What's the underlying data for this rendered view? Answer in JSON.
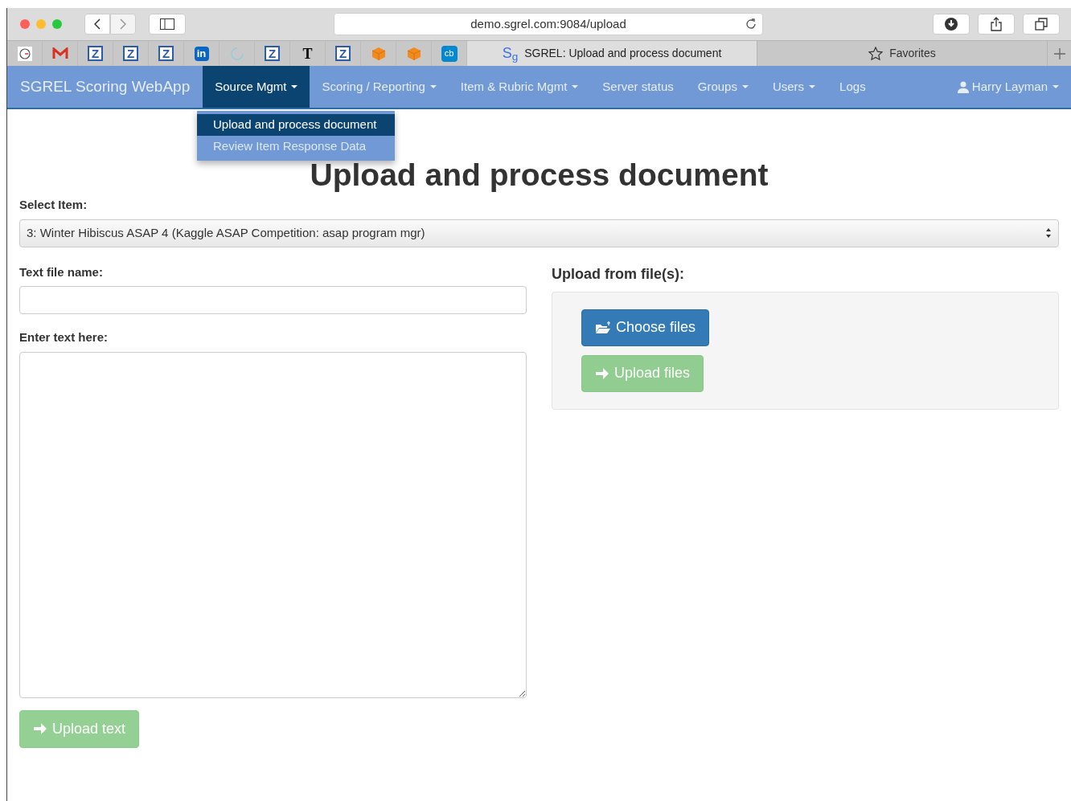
{
  "browser": {
    "url": "demo.sgrel.com:9084/upload",
    "bookmarks": [
      {
        "kind": "clock"
      },
      {
        "kind": "gmail"
      },
      {
        "kind": "z",
        "label": "Z"
      },
      {
        "kind": "z",
        "label": "Z"
      },
      {
        "kind": "z",
        "label": "Z"
      },
      {
        "kind": "linkedin",
        "label": "in"
      },
      {
        "kind": "spinner"
      },
      {
        "kind": "z",
        "label": "Z"
      },
      {
        "kind": "nyt",
        "label": "T"
      },
      {
        "kind": "z",
        "label": "Z"
      },
      {
        "kind": "cube"
      },
      {
        "kind": "cube"
      },
      {
        "kind": "cb",
        "label": "cb"
      }
    ],
    "tab": {
      "favicon": "S$_{g}$",
      "title": "SGREL: Upload and process document"
    },
    "favorites": "Favorites"
  },
  "navbar": {
    "brand": "SGREL Scoring WebApp",
    "items": [
      {
        "label": "Source Mgmt",
        "dropdown": true,
        "selected": true
      },
      {
        "label": "Scoring / Reporting",
        "dropdown": true,
        "selected": false
      },
      {
        "label": "Item & Rubric Mgmt",
        "dropdown": true,
        "selected": false
      },
      {
        "label": "Server status",
        "dropdown": false,
        "selected": false
      },
      {
        "label": "Groups",
        "dropdown": true,
        "selected": false
      },
      {
        "label": "Users",
        "dropdown": true,
        "selected": false
      },
      {
        "label": "Logs",
        "dropdown": false,
        "selected": false
      }
    ],
    "user": {
      "label": "Harry Layman",
      "dropdown": true
    },
    "menu": [
      {
        "label": "Upload and process document",
        "selected": true
      },
      {
        "label": "Review Item Response Data",
        "selected": false
      }
    ]
  },
  "page": {
    "title": "Upload and process document",
    "select_label": "Select Item:",
    "select_value": "3: Winter Hibiscus ASAP 4 (Kaggle ASAP Competition: asap program mgr)",
    "file_name_label": "Text file name:",
    "text_label": "Enter text here:",
    "upload_text": {
      "label": "Upload text",
      "disabled": true
    },
    "upload_heading": "Upload from file(s):",
    "file_buttons": [
      {
        "kind": "choose",
        "label": "Choose files",
        "disabled": false
      },
      {
        "kind": "upload",
        "label": "Upload files",
        "disabled": true
      }
    ]
  }
}
